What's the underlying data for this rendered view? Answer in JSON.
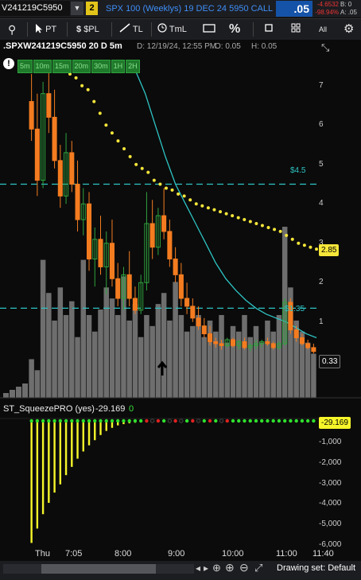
{
  "header": {
    "symbol": "V241219C5950",
    "link_badge": "2",
    "description": "SPX 100 (Weeklys) 19 DEC 24 5950 CALL",
    "last_price": ".05",
    "change": "-4.6532",
    "change_pct": "-98.94%",
    "bid": "B: 0",
    "ask": "A: .05"
  },
  "toolbar": {
    "pt_label": "PT",
    "pl_label": "$PL",
    "tl_label": "TL",
    "tml_label": "TmL",
    "percent_label": "%",
    "all_label": "All"
  },
  "info": {
    "symbol": ".SPXW241219C5950 20 D 5m",
    "date": "D: 12/19/24, 12:55 PM",
    "open": "O: 0.05",
    "high": "H: 0.05"
  },
  "timeframes": [
    "5m",
    "10m",
    "15m",
    "20m",
    "30m",
    "1H",
    "2H"
  ],
  "price_flags": {
    "current": "2.85",
    "last": "0.33"
  },
  "level_labels": {
    "upper": "$4.5",
    "lower": "$1.35"
  },
  "study": {
    "name": "ST_SqueezePRO (yes)",
    "value": "-29.169",
    "zero": "0",
    "flag": "-29.169"
  },
  "bottom": {
    "drawing_set": "Drawing set: Default"
  },
  "colors": {
    "up_candle": "#2fa23e",
    "down_candle": "#f47c20",
    "volume": "#6e6e6e",
    "dotted_ma": "#f5e63a",
    "cyan_line": "#2ec4c4",
    "histogram": "#f5f52a",
    "accent_blue": "#1553a8"
  },
  "chart_data": {
    "type": "line",
    "price_axis": {
      "labels": [
        "7",
        "6",
        "5",
        "4",
        "3",
        "2",
        "1",
        "0"
      ],
      "ylim": [
        -0.4,
        7.4
      ]
    },
    "time_axis": {
      "labels": [
        "Thu",
        "7:05",
        "8:00",
        "9:00",
        "10:00",
        "11:00",
        "11:40"
      ]
    },
    "horizontal_levels": [
      4.5,
      1.35
    ],
    "series": [
      {
        "kind": "candles",
        "ohlc": [
          [
            6.6,
            7.3,
            5.6,
            5.9
          ],
          [
            5.9,
            6.8,
            4.2,
            4.6
          ],
          [
            4.6,
            7.1,
            4.4,
            6.8
          ],
          [
            6.8,
            7.4,
            5.8,
            6.2
          ],
          [
            6.2,
            6.9,
            4.9,
            5.1
          ],
          [
            5.1,
            5.5,
            3.9,
            4.2
          ],
          [
            4.2,
            5.8,
            4.0,
            5.3
          ],
          [
            5.3,
            5.6,
            4.3,
            4.5
          ],
          [
            4.5,
            5.1,
            3.3,
            3.6
          ],
          [
            3.6,
            4.4,
            3.2,
            4.0
          ],
          [
            4.0,
            4.3,
            2.3,
            2.6
          ],
          [
            2.6,
            3.4,
            1.9,
            3.1
          ],
          [
            3.1,
            3.7,
            2.2,
            2.4
          ],
          [
            2.4,
            3.3,
            1.7,
            3.0
          ],
          [
            3.0,
            3.6,
            1.9,
            2.1
          ],
          [
            2.1,
            2.5,
            1.4,
            1.6
          ],
          [
            1.6,
            2.4,
            1.3,
            2.2
          ],
          [
            2.2,
            2.8,
            1.4,
            1.6
          ],
          [
            1.6,
            1.9,
            1.2,
            1.3
          ],
          [
            1.3,
            2.2,
            1.2,
            2.0
          ],
          [
            2.0,
            4.3,
            1.8,
            3.5
          ],
          [
            3.5,
            4.1,
            2.6,
            2.9
          ],
          [
            2.9,
            3.9,
            2.7,
            3.7
          ],
          [
            3.7,
            4.4,
            3.1,
            3.3
          ],
          [
            3.3,
            3.6,
            2.4,
            2.6
          ],
          [
            2.6,
            2.9,
            2.0,
            2.2
          ],
          [
            2.2,
            2.5,
            1.4,
            1.6
          ],
          [
            1.6,
            2.0,
            1.2,
            1.4
          ],
          [
            1.4,
            1.6,
            1.0,
            1.1
          ],
          [
            1.1,
            1.4,
            0.8,
            0.9
          ],
          [
            0.9,
            1.1,
            0.6,
            0.7
          ],
          [
            0.7,
            0.9,
            0.4,
            0.5
          ],
          [
            0.5,
            0.6,
            0.35,
            0.45
          ],
          [
            0.45,
            0.55,
            0.3,
            0.4
          ],
          [
            0.4,
            0.6,
            0.35,
            0.55
          ],
          [
            0.55,
            0.6,
            0.35,
            0.4
          ],
          [
            0.4,
            0.55,
            0.3,
            0.5
          ],
          [
            0.5,
            0.6,
            0.3,
            0.35
          ],
          [
            0.35,
            0.45,
            0.25,
            0.4
          ],
          [
            0.4,
            0.55,
            0.3,
            0.45
          ],
          [
            0.45,
            0.55,
            0.35,
            0.5
          ],
          [
            0.5,
            0.6,
            0.4,
            0.45
          ],
          [
            0.45,
            0.5,
            0.3,
            0.35
          ],
          [
            0.35,
            0.5,
            0.3,
            0.45
          ],
          [
            0.45,
            1.6,
            0.4,
            1.5
          ],
          [
            1.5,
            1.6,
            0.7,
            0.8
          ],
          [
            0.8,
            0.9,
            0.5,
            0.6
          ],
          [
            0.6,
            0.7,
            0.4,
            0.45
          ],
          [
            0.45,
            0.55,
            0.3,
            0.35
          ],
          [
            0.35,
            0.45,
            0.2,
            0.25
          ]
        ]
      },
      {
        "kind": "dotted_average",
        "values": [
          7.3,
          7.2,
          7.0,
          6.9,
          6.6,
          6.3,
          6.0,
          5.8,
          5.6,
          5.4,
          5.2,
          5.0,
          4.9,
          4.8,
          4.6,
          4.5,
          4.4,
          4.35,
          4.25,
          4.2,
          4.1,
          4.0,
          3.95,
          3.9,
          3.85,
          3.8,
          3.75,
          3.7,
          3.65,
          3.6,
          3.55,
          3.5,
          3.45,
          3.4,
          3.35,
          3.3,
          3.2,
          3.1,
          3.0,
          2.95,
          2.9,
          2.85
        ]
      },
      {
        "kind": "line",
        "values": [
          7.4,
          6.8,
          6.0,
          5.2,
          4.5,
          4.0,
          3.5,
          3.0,
          2.5,
          2.1,
          1.8,
          1.55,
          1.35,
          1.2,
          1.1,
          1.0,
          0.85,
          0.7,
          0.6
        ]
      }
    ],
    "volume": [
      14,
      10,
      50,
      38,
      28,
      40,
      30,
      35,
      22,
      50,
      30,
      24,
      32,
      40,
      36,
      30,
      44,
      28,
      34,
      22,
      30,
      26,
      34,
      38,
      28,
      42,
      30,
      24,
      26,
      30,
      22,
      28,
      24,
      30,
      20,
      26,
      24,
      30,
      22,
      26,
      20,
      28,
      24,
      30,
      62,
      40,
      28,
      24,
      20,
      16
    ],
    "study": {
      "name": "ST_SqueezePRO (yes)",
      "ylim": [
        -6000,
        0
      ],
      "y_labels": [
        "-1,000",
        "-2,000",
        "-3,000",
        "-4,000",
        "-5,000",
        "-6,000"
      ],
      "values": [
        -5900,
        -5200,
        -4500,
        -3950,
        -3450,
        -3050,
        -2600,
        -2200,
        -1800,
        -1450,
        -1150,
        -900,
        -650,
        -450,
        -300,
        -180,
        -120,
        -80,
        -50,
        -30,
        -20,
        -15,
        -10,
        -8,
        -6,
        -5,
        -4,
        -3,
        -3,
        -3,
        -3,
        -3,
        -3,
        -3,
        -3,
        -3,
        -3,
        -3,
        -3,
        -3,
        -3,
        -3,
        -3,
        -3,
        -3,
        -3,
        -3,
        -3,
        -3,
        -3
      ],
      "dots": [
        "green",
        "green",
        "green",
        "green",
        "green",
        "green",
        "green",
        "green",
        "green",
        "green",
        "green",
        "green",
        "green",
        "green",
        "green",
        "green",
        "green",
        "green",
        "green",
        "green",
        "red",
        "black",
        "red",
        "green",
        "black",
        "red",
        "black",
        "green",
        "red",
        "black",
        "green",
        "red",
        "green",
        "black",
        "red",
        "green",
        "green",
        "green",
        "green",
        "green",
        "green",
        "green",
        "green",
        "green",
        "green",
        "green",
        "green",
        "green",
        "green",
        "green"
      ]
    }
  }
}
